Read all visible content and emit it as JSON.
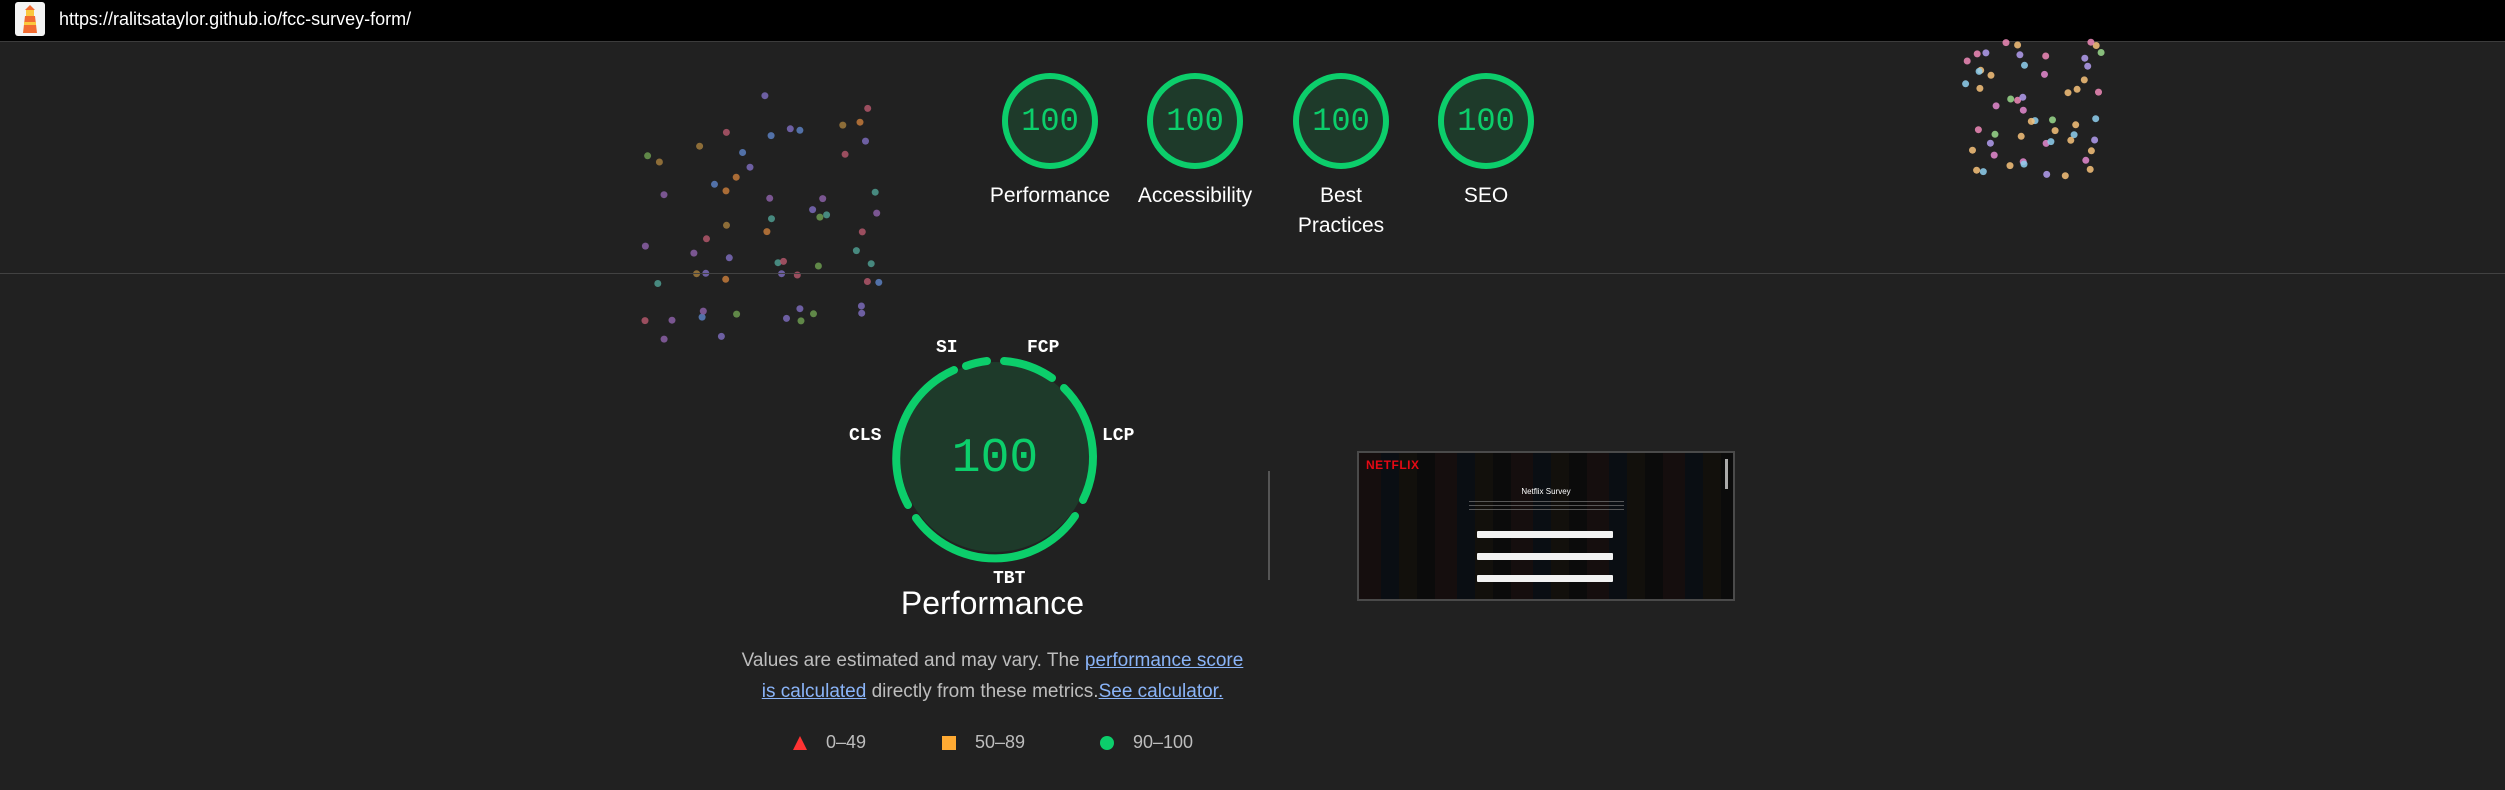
{
  "browser": {
    "url": "https://ralitsataylor.github.io/fcc-survey-form/",
    "logo_icon": "lighthouse-icon"
  },
  "summary_gauges": [
    {
      "score": "100",
      "label": "Performance"
    },
    {
      "score": "100",
      "label": "Accessibility"
    },
    {
      "score": "100",
      "label": "Best Practices"
    },
    {
      "score": "100",
      "label": "SEO"
    }
  ],
  "performance": {
    "score": "100",
    "title": "Performance",
    "metrics": [
      "SI",
      "FCP",
      "LCP",
      "TBT",
      "CLS"
    ],
    "note_prefix": "Values are estimated and may vary. The ",
    "note_link1": "performance score is calculated",
    "note_middle": " directly from these metrics.",
    "note_link2": "See calculator."
  },
  "legend": [
    {
      "range": "0–49",
      "icon": "triangle-icon",
      "color": "#ff3333"
    },
    {
      "range": "50–89",
      "icon": "square-icon",
      "color": "#ffaa33"
    },
    {
      "range": "90–100",
      "icon": "circle-icon",
      "color": "#0cce6b"
    }
  ],
  "screenshot": {
    "brand": "NETFLIX",
    "title": "Netflix Survey"
  },
  "colors": {
    "pass": "#0cce6b",
    "background": "#212121",
    "link": "#8ab4f8"
  }
}
